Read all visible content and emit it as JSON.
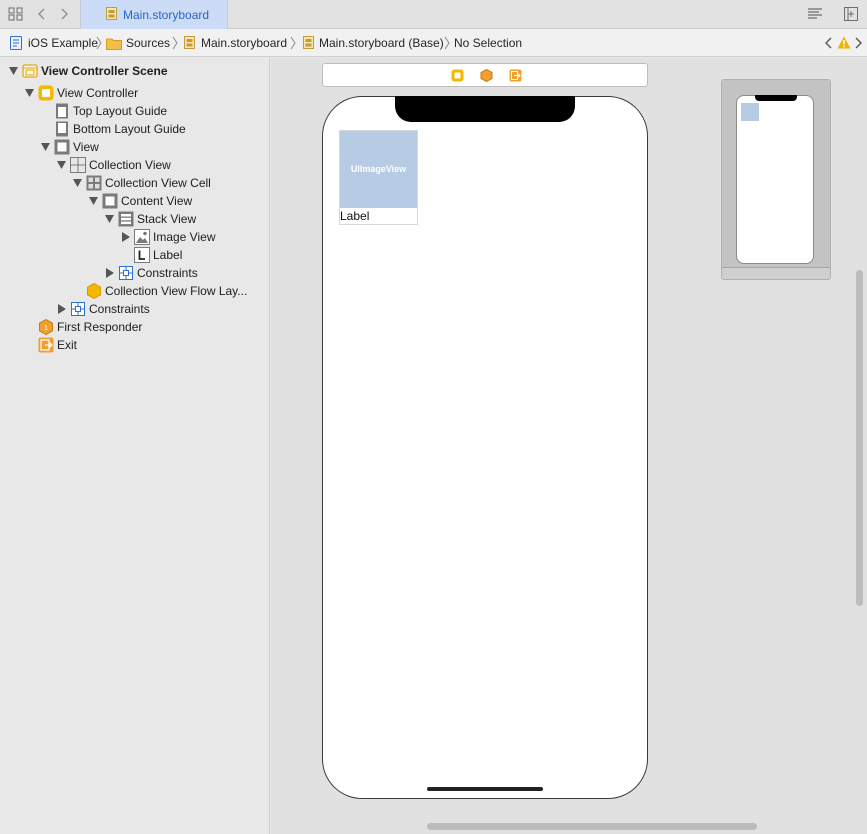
{
  "tab": {
    "title": "Main.storyboard"
  },
  "jumpbar": {
    "items": [
      "iOS Example",
      "Sources",
      "Main.storyboard",
      "Main.storyboard (Base)",
      "No Selection"
    ]
  },
  "outline": {
    "items": [
      {
        "label": "View Controller Scene",
        "icon": "scene-icon"
      },
      {
        "label": "View Controller",
        "icon": "view-controller-icon"
      },
      {
        "label": "Top Layout Guide",
        "icon": "layout-guide-icon"
      },
      {
        "label": "Bottom Layout Guide",
        "icon": "layout-guide-icon"
      },
      {
        "label": "View",
        "icon": "view-icon"
      },
      {
        "label": "Collection View",
        "icon": "collection-view-icon"
      },
      {
        "label": "Collection View Cell",
        "icon": "collection-view-cell-icon"
      },
      {
        "label": "Content View",
        "icon": "view-icon"
      },
      {
        "label": "Stack View",
        "icon": "stack-view-icon"
      },
      {
        "label": "Image View",
        "icon": "image-view-icon"
      },
      {
        "label": "Label",
        "icon": "label-icon"
      },
      {
        "label": "Constraints",
        "icon": "constraints-icon"
      },
      {
        "label": "Collection View Flow Lay...",
        "icon": "flow-layout-icon"
      },
      {
        "label": "Constraints",
        "icon": "constraints-icon"
      },
      {
        "label": "First Responder",
        "icon": "first-responder-icon"
      },
      {
        "label": "Exit",
        "icon": "exit-icon"
      }
    ]
  },
  "canvas": {
    "image_view_text": "UIImageView",
    "cell_label": "Label"
  },
  "colors": {
    "accent": "#2a64c8",
    "tab_bg": "#cddcf6",
    "image_view": "#b8cbe4",
    "warning": "#f0b400"
  }
}
